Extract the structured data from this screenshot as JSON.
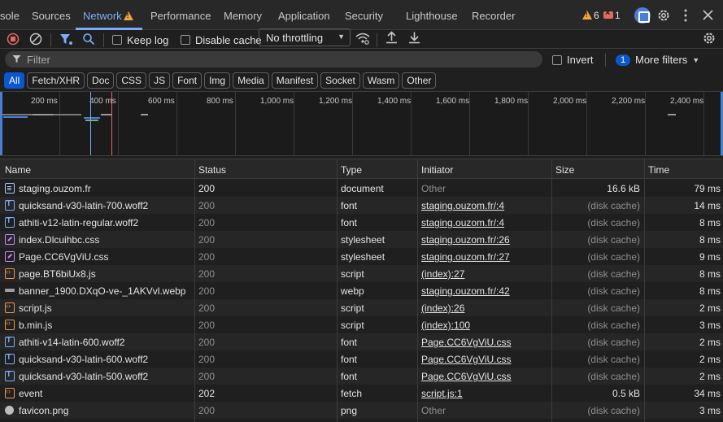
{
  "tabs": [
    {
      "label": "sole",
      "active": false
    },
    {
      "label": "Sources",
      "active": false
    },
    {
      "label": "Network",
      "active": true
    },
    {
      "label": "Performance",
      "active": false
    },
    {
      "label": "Memory",
      "active": false
    },
    {
      "label": "Application",
      "active": false
    },
    {
      "label": "Security",
      "active": false
    },
    {
      "label": "Lighthouse",
      "active": false
    },
    {
      "label": "Recorder",
      "active": false
    }
  ],
  "status": {
    "warnings": "6",
    "errors": "1"
  },
  "toolbar": {
    "keep_log": "Keep log",
    "disable_cache": "Disable cache",
    "throttling": "No throttling"
  },
  "filter": {
    "placeholder": "Filter",
    "invert": "Invert",
    "more_filters_count": "1",
    "more_filters": "More filters"
  },
  "type_filters": [
    "All",
    "Fetch/XHR",
    "Doc",
    "CSS",
    "JS",
    "Font",
    "Img",
    "Media",
    "Manifest",
    "Socket",
    "Wasm",
    "Other"
  ],
  "overview": {
    "ticks": [
      "200 ms",
      "400 ms",
      "600 ms",
      "800 ms",
      "1,000 ms",
      "1,200 ms",
      "1,400 ms",
      "1,600 ms",
      "1,800 ms",
      "2,000 ms",
      "2,200 ms",
      "2,400 ms"
    ]
  },
  "columns": [
    "Name",
    "Status",
    "Type",
    "Initiator",
    "Size",
    "Time"
  ],
  "rows": [
    {
      "icon": "doc",
      "name": "staging.ouzom.fr",
      "status": "200",
      "type": "document",
      "initiator": "Other",
      "initiator_link": false,
      "size": "16.6 kB",
      "size_dim": false,
      "time": "79 ms",
      "status_dim": false
    },
    {
      "icon": "font",
      "name": "quicksand-v30-latin-700.woff2",
      "status": "200",
      "type": "font",
      "initiator": "staging.ouzom.fr/:4",
      "initiator_link": true,
      "size": "(disk cache)",
      "size_dim": true,
      "time": "14 ms",
      "status_dim": true
    },
    {
      "icon": "font",
      "name": "athiti-v12-latin-regular.woff2",
      "status": "200",
      "type": "font",
      "initiator": "staging.ouzom.fr/:4",
      "initiator_link": true,
      "size": "(disk cache)",
      "size_dim": true,
      "time": "8 ms",
      "status_dim": true
    },
    {
      "icon": "css",
      "name": "index.Dlcuihbc.css",
      "status": "200",
      "type": "stylesheet",
      "initiator": "staging.ouzom.fr/:26",
      "initiator_link": true,
      "size": "(disk cache)",
      "size_dim": true,
      "time": "8 ms",
      "status_dim": true
    },
    {
      "icon": "css",
      "name": "Page.CC6VgViU.css",
      "status": "200",
      "type": "stylesheet",
      "initiator": "staging.ouzom.fr/:27",
      "initiator_link": true,
      "size": "(disk cache)",
      "size_dim": true,
      "time": "9 ms",
      "status_dim": true
    },
    {
      "icon": "script",
      "name": "page.BT6biUx8.js",
      "status": "200",
      "type": "script",
      "initiator": "(index):27",
      "initiator_link": true,
      "size": "(disk cache)",
      "size_dim": true,
      "time": "8 ms",
      "status_dim": true
    },
    {
      "icon": "img",
      "name": "banner_1900.DXqO-ve-_1AKVvl.webp",
      "status": "200",
      "type": "webp",
      "initiator": "staging.ouzom.fr/:42",
      "initiator_link": true,
      "size": "(disk cache)",
      "size_dim": true,
      "time": "8 ms",
      "status_dim": true
    },
    {
      "icon": "script",
      "name": "script.js",
      "status": "200",
      "type": "script",
      "initiator": "(index):26",
      "initiator_link": true,
      "size": "(disk cache)",
      "size_dim": true,
      "time": "2 ms",
      "status_dim": true
    },
    {
      "icon": "script",
      "name": "b.min.js",
      "status": "200",
      "type": "script",
      "initiator": "(index):100",
      "initiator_link": true,
      "size": "(disk cache)",
      "size_dim": true,
      "time": "3 ms",
      "status_dim": true
    },
    {
      "icon": "font",
      "name": "athiti-v14-latin-600.woff2",
      "status": "200",
      "type": "font",
      "initiator": "Page.CC6VgViU.css",
      "initiator_link": true,
      "size": "(disk cache)",
      "size_dim": true,
      "time": "2 ms",
      "status_dim": true
    },
    {
      "icon": "font",
      "name": "quicksand-v30-latin-600.woff2",
      "status": "200",
      "type": "font",
      "initiator": "Page.CC6VgViU.css",
      "initiator_link": true,
      "size": "(disk cache)",
      "size_dim": true,
      "time": "2 ms",
      "status_dim": true
    },
    {
      "icon": "font",
      "name": "quicksand-v30-latin-500.woff2",
      "status": "200",
      "type": "font",
      "initiator": "Page.CC6VgViU.css",
      "initiator_link": true,
      "size": "(disk cache)",
      "size_dim": true,
      "time": "2 ms",
      "status_dim": true
    },
    {
      "icon": "fetch",
      "name": "event",
      "status": "202",
      "type": "fetch",
      "initiator": "script.js:1",
      "initiator_link": true,
      "size": "0.5 kB",
      "size_dim": false,
      "time": "34 ms",
      "status_dim": false
    },
    {
      "icon": "png",
      "name": "favicon.png",
      "status": "200",
      "type": "png",
      "initiator": "Other",
      "initiator_link": false,
      "size": "(disk cache)",
      "size_dim": true,
      "time": "3 ms",
      "status_dim": true
    }
  ]
}
